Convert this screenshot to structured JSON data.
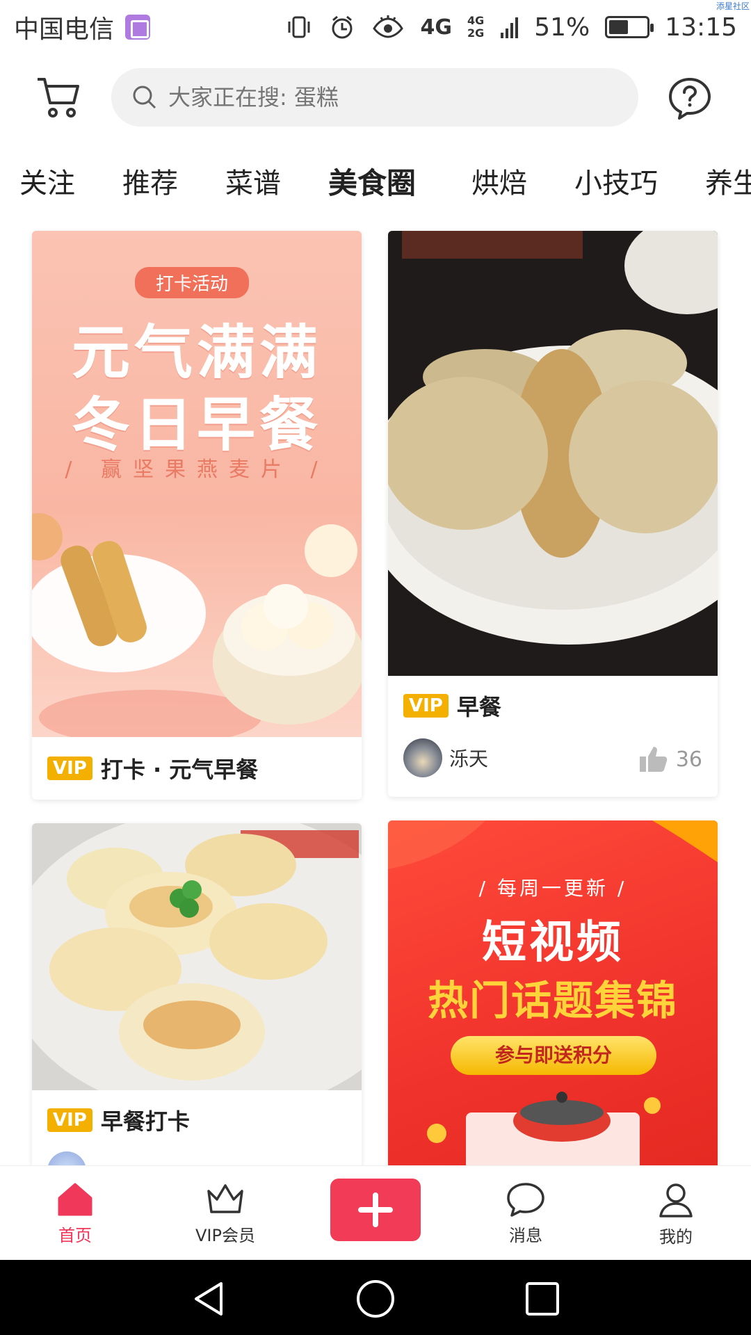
{
  "status": {
    "carrier": "中国电信",
    "net1": "4G",
    "net2": "4G",
    "net3": "2G",
    "battery_pct": "51%",
    "battery_level": 0.51,
    "time": "13:15",
    "watermark": "添星社区"
  },
  "search": {
    "placeholder": "大家正在搜: 蛋糕"
  },
  "tabs": [
    "关注",
    "推荐",
    "菜谱",
    "美食圈",
    "烘焙",
    "小技巧",
    "养生"
  ],
  "active_tab": "美食圈",
  "cards": [
    {
      "vip": "VIP",
      "title": "打卡 · 元气早餐",
      "banner": {
        "pill": "打卡活动",
        "line1": "元气满满",
        "line2": "冬日早餐",
        "sub": "/ 赢坚果燕麦片 /"
      }
    },
    {
      "vip": "VIP",
      "title": "早餐",
      "author": "泺天",
      "likes": "36"
    },
    {
      "vip": "VIP",
      "title": "早餐打卡"
    },
    {
      "banner": {
        "line1": "/ 每周一更新 /",
        "line2": "短视频",
        "line3": "热门话题集锦",
        "cta": "参与即送积分"
      }
    }
  ],
  "nav": {
    "home": "首页",
    "vip": "VIP会员",
    "messages": "消息",
    "me": "我的"
  },
  "colors": {
    "accent": "#f0385a",
    "vip": "#f3b000"
  }
}
